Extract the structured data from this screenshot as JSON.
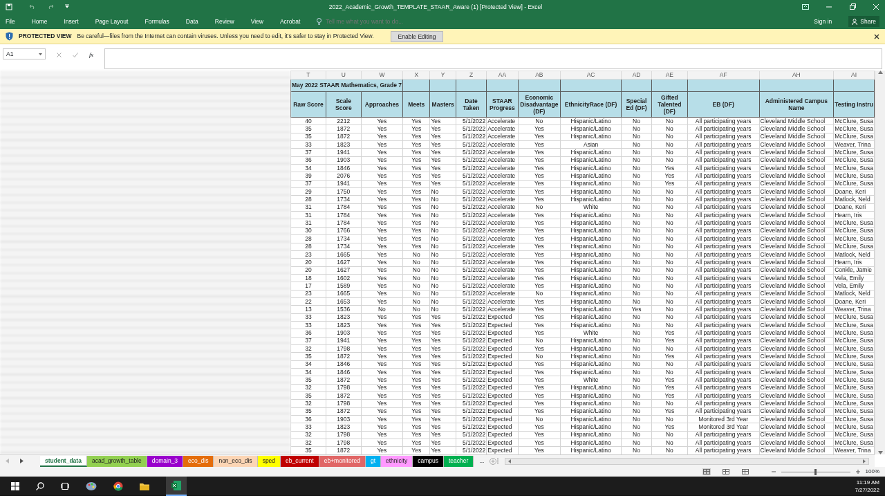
{
  "window": {
    "title": "2022_Academic_Growth_TEMPLATE_STAAR_Aware (1)  [Protected View] - Excel"
  },
  "ribbon_tabs": [
    "File",
    "Home",
    "Insert",
    "Page Layout",
    "Formulas",
    "Data",
    "Review",
    "View",
    "Acrobat"
  ],
  "tell_me": {
    "placeholder": "Tell me what you want to do..."
  },
  "account": {
    "sign_in": "Sign in",
    "share": "Share"
  },
  "protected_view": {
    "title": "PROTECTED VIEW",
    "message": "Be careful—files from the Internet can contain viruses. Unless you need to edit, it's safer to stay in Protected View.",
    "button": "Enable Editing"
  },
  "formula_bar": {
    "name_box": "A1",
    "fx": "fx"
  },
  "sheet": {
    "column_letters": [
      "T",
      "U",
      "W",
      "X",
      "Y",
      "Z",
      "AA",
      "AB",
      "AC",
      "AD",
      "AE",
      "AF",
      "AH",
      "AI"
    ],
    "title": "May 2022 STAAR Mathematics, Grade 7",
    "columns": [
      "Raw Score",
      "Scale Score",
      "Approaches",
      "Meets",
      "Masters",
      "Date Taken",
      "STAAR Progress",
      "Economic Disadvantage (DF)",
      "EthnicityRace (DF)",
      "Special Ed (DF)",
      "Gifted Talented (DF)",
      "EB (DF)",
      "Administered Campus Name",
      "Testing Instru"
    ],
    "rows": [
      [
        "40",
        "2212",
        "Yes",
        "Yes",
        "Yes",
        "5/1/2022",
        "Accelerate",
        "No",
        "Hispanic/Latino",
        "No",
        "No",
        "All participating years",
        "Cleveland Middle School",
        "McClure, Susa"
      ],
      [
        "35",
        "1872",
        "Yes",
        "Yes",
        "Yes",
        "5/1/2022",
        "Accelerate",
        "Yes",
        "Hispanic/Latino",
        "No",
        "No",
        "All participating years",
        "Cleveland Middle School",
        "McClure, Susa"
      ],
      [
        "35",
        "1872",
        "Yes",
        "Yes",
        "Yes",
        "5/1/2022",
        "Accelerate",
        "Yes",
        "Hispanic/Latino",
        "No",
        "No",
        "All participating years",
        "Cleveland Middle School",
        "McClure, Susa"
      ],
      [
        "33",
        "1823",
        "Yes",
        "Yes",
        "Yes",
        "5/1/2022",
        "Accelerate",
        "Yes",
        "Asian",
        "No",
        "No",
        "All participating years",
        "Cleveland Middle School",
        "Weaver, Trina"
      ],
      [
        "37",
        "1941",
        "Yes",
        "Yes",
        "Yes",
        "5/1/2022",
        "Accelerate",
        "Yes",
        "Hispanic/Latino",
        "No",
        "No",
        "All participating years",
        "Cleveland Middle School",
        "McClure, Susa"
      ],
      [
        "36",
        "1903",
        "Yes",
        "Yes",
        "Yes",
        "5/1/2022",
        "Accelerate",
        "Yes",
        "Hispanic/Latino",
        "No",
        "No",
        "All participating years",
        "Cleveland Middle School",
        "McClure, Susa"
      ],
      [
        "34",
        "1846",
        "Yes",
        "Yes",
        "Yes",
        "5/1/2022",
        "Accelerate",
        "Yes",
        "Hispanic/Latino",
        "No",
        "Yes",
        "All participating years",
        "Cleveland Middle School",
        "McClure, Susa"
      ],
      [
        "39",
        "2076",
        "Yes",
        "Yes",
        "Yes",
        "5/1/2022",
        "Accelerate",
        "Yes",
        "Hispanic/Latino",
        "No",
        "Yes",
        "All participating years",
        "Cleveland Middle School",
        "McClure, Susa"
      ],
      [
        "37",
        "1941",
        "Yes",
        "Yes",
        "Yes",
        "5/1/2022",
        "Accelerate",
        "Yes",
        "Hispanic/Latino",
        "No",
        "Yes",
        "All participating years",
        "Cleveland Middle School",
        "McClure, Susa"
      ],
      [
        "29",
        "1750",
        "Yes",
        "Yes",
        "No",
        "5/1/2022",
        "Accelerate",
        "Yes",
        "Hispanic/Latino",
        "No",
        "No",
        "All participating years",
        "Cleveland Middle School",
        "Doane, Keri"
      ],
      [
        "28",
        "1734",
        "Yes",
        "Yes",
        "No",
        "5/1/2022",
        "Accelerate",
        "Yes",
        "Hispanic/Latino",
        "No",
        "No",
        "All participating years",
        "Cleveland Middle School",
        "Matlock, Neld"
      ],
      [
        "31",
        "1784",
        "Yes",
        "Yes",
        "No",
        "5/1/2022",
        "Accelerate",
        "No",
        "White",
        "No",
        "No",
        "All participating years",
        "Cleveland Middle School",
        "Doane, Keri"
      ],
      [
        "31",
        "1784",
        "Yes",
        "Yes",
        "No",
        "5/1/2022",
        "Accelerate",
        "Yes",
        "Hispanic/Latino",
        "No",
        "No",
        "All participating years",
        "Cleveland Middle School",
        "Hearn, Iris"
      ],
      [
        "31",
        "1784",
        "Yes",
        "Yes",
        "No",
        "5/1/2022",
        "Accelerate",
        "Yes",
        "Hispanic/Latino",
        "No",
        "No",
        "All participating years",
        "Cleveland Middle School",
        "McClure, Susa"
      ],
      [
        "30",
        "1766",
        "Yes",
        "Yes",
        "No",
        "5/1/2022",
        "Accelerate",
        "Yes",
        "Hispanic/Latino",
        "No",
        "No",
        "All participating years",
        "Cleveland Middle School",
        "McClure, Susa"
      ],
      [
        "28",
        "1734",
        "Yes",
        "Yes",
        "No",
        "5/1/2022",
        "Accelerate",
        "Yes",
        "Hispanic/Latino",
        "No",
        "No",
        "All participating years",
        "Cleveland Middle School",
        "McClure, Susa"
      ],
      [
        "28",
        "1734",
        "Yes",
        "Yes",
        "No",
        "5/1/2022",
        "Accelerate",
        "Yes",
        "Hispanic/Latino",
        "No",
        "No",
        "All participating years",
        "Cleveland Middle School",
        "McClure, Susa"
      ],
      [
        "23",
        "1665",
        "Yes",
        "No",
        "No",
        "5/1/2022",
        "Accelerate",
        "Yes",
        "Hispanic/Latino",
        "No",
        "No",
        "All participating years",
        "Cleveland Middle School",
        "Matlock, Neld"
      ],
      [
        "20",
        "1627",
        "Yes",
        "No",
        "No",
        "5/1/2022",
        "Accelerate",
        "Yes",
        "Hispanic/Latino",
        "No",
        "No",
        "All participating years",
        "Cleveland Middle School",
        "Hearn, Iris"
      ],
      [
        "20",
        "1627",
        "Yes",
        "No",
        "No",
        "5/1/2022",
        "Accelerate",
        "Yes",
        "Hispanic/Latino",
        "No",
        "No",
        "All participating years",
        "Cleveland Middle School",
        "Conkle, Jamie"
      ],
      [
        "18",
        "1602",
        "Yes",
        "No",
        "No",
        "5/1/2022",
        "Accelerate",
        "Yes",
        "Hispanic/Latino",
        "No",
        "No",
        "All participating years",
        "Cleveland Middle School",
        "Vela, Emily"
      ],
      [
        "17",
        "1589",
        "Yes",
        "No",
        "No",
        "5/1/2022",
        "Accelerate",
        "Yes",
        "Hispanic/Latino",
        "No",
        "No",
        "All participating years",
        "Cleveland Middle School",
        "Vela, Emily"
      ],
      [
        "23",
        "1665",
        "Yes",
        "No",
        "No",
        "5/1/2022",
        "Accelerate",
        "No",
        "Hispanic/Latino",
        "No",
        "No",
        "All participating years",
        "Cleveland Middle School",
        "Matlock, Neld"
      ],
      [
        "22",
        "1653",
        "Yes",
        "No",
        "No",
        "5/1/2022",
        "Accelerate",
        "Yes",
        "Hispanic/Latino",
        "No",
        "No",
        "All participating years",
        "Cleveland Middle School",
        "Doane, Keri"
      ],
      [
        "13",
        "1536",
        "No",
        "No",
        "No",
        "5/1/2022",
        "Accelerate",
        "Yes",
        "Hispanic/Latino",
        "Yes",
        "No",
        "All participating years",
        "Cleveland Middle School",
        "Weaver, Trina"
      ],
      [
        "33",
        "1823",
        "Yes",
        "Yes",
        "Yes",
        "5/1/2022",
        "Expected",
        "Yes",
        "Hispanic/Latino",
        "No",
        "No",
        "All participating years",
        "Cleveland Middle School",
        "McClure, Susa"
      ],
      [
        "33",
        "1823",
        "Yes",
        "Yes",
        "Yes",
        "5/1/2022",
        "Expected",
        "Yes",
        "Hispanic/Latino",
        "No",
        "No",
        "All participating years",
        "Cleveland Middle School",
        "McClure, Susa"
      ],
      [
        "36",
        "1903",
        "Yes",
        "Yes",
        "Yes",
        "5/1/2022",
        "Expected",
        "Yes",
        "White",
        "No",
        "Yes",
        "All participating years",
        "Cleveland Middle School",
        "McClure, Susa"
      ],
      [
        "37",
        "1941",
        "Yes",
        "Yes",
        "Yes",
        "5/1/2022",
        "Expected",
        "No",
        "Hispanic/Latino",
        "No",
        "Yes",
        "All participating years",
        "Cleveland Middle School",
        "McClure, Susa"
      ],
      [
        "32",
        "1798",
        "Yes",
        "Yes",
        "Yes",
        "5/1/2022",
        "Expected",
        "Yes",
        "Hispanic/Latino",
        "No",
        "No",
        "All participating years",
        "Cleveland Middle School",
        "McClure, Susa"
      ],
      [
        "35",
        "1872",
        "Yes",
        "Yes",
        "Yes",
        "5/1/2022",
        "Expected",
        "No",
        "Hispanic/Latino",
        "No",
        "Yes",
        "All participating years",
        "Cleveland Middle School",
        "McClure, Susa"
      ],
      [
        "34",
        "1846",
        "Yes",
        "Yes",
        "Yes",
        "5/1/2022",
        "Expected",
        "Yes",
        "Hispanic/Latino",
        "No",
        "No",
        "All participating years",
        "Cleveland Middle School",
        "McClure, Susa"
      ],
      [
        "34",
        "1846",
        "Yes",
        "Yes",
        "Yes",
        "5/1/2022",
        "Expected",
        "Yes",
        "Hispanic/Latino",
        "No",
        "No",
        "All participating years",
        "Cleveland Middle School",
        "McClure, Susa"
      ],
      [
        "35",
        "1872",
        "Yes",
        "Yes",
        "Yes",
        "5/1/2022",
        "Expected",
        "Yes",
        "White",
        "No",
        "Yes",
        "All participating years",
        "Cleveland Middle School",
        "McClure, Susa"
      ],
      [
        "32",
        "1798",
        "Yes",
        "Yes",
        "Yes",
        "5/1/2022",
        "Expected",
        "Yes",
        "Hispanic/Latino",
        "No",
        "Yes",
        "All participating years",
        "Cleveland Middle School",
        "McClure, Susa"
      ],
      [
        "35",
        "1872",
        "Yes",
        "Yes",
        "Yes",
        "5/1/2022",
        "Expected",
        "Yes",
        "Hispanic/Latino",
        "No",
        "Yes",
        "All participating years",
        "Cleveland Middle School",
        "McClure, Susa"
      ],
      [
        "32",
        "1798",
        "Yes",
        "Yes",
        "Yes",
        "5/1/2022",
        "Expected",
        "Yes",
        "Hispanic/Latino",
        "No",
        "No",
        "All participating years",
        "Cleveland Middle School",
        "McClure, Susa"
      ],
      [
        "35",
        "1872",
        "Yes",
        "Yes",
        "Yes",
        "5/1/2022",
        "Expected",
        "Yes",
        "Hispanic/Latino",
        "No",
        "Yes",
        "All participating years",
        "Cleveland Middle School",
        "McClure, Susa"
      ],
      [
        "36",
        "1903",
        "Yes",
        "Yes",
        "Yes",
        "5/1/2022",
        "Expected",
        "No",
        "Hispanic/Latino",
        "No",
        "No",
        "Monitored 3rd Year",
        "Cleveland Middle School",
        "McClure, Susa"
      ],
      [
        "33",
        "1823",
        "Yes",
        "Yes",
        "Yes",
        "5/1/2022",
        "Expected",
        "Yes",
        "Hispanic/Latino",
        "No",
        "Yes",
        "Monitored 3rd Year",
        "Cleveland Middle School",
        "McClure, Susa"
      ],
      [
        "32",
        "1798",
        "Yes",
        "Yes",
        "Yes",
        "5/1/2022",
        "Expected",
        "Yes",
        "Hispanic/Latino",
        "No",
        "No",
        "All participating years",
        "Cleveland Middle School",
        "McClure, Susa"
      ],
      [
        "32",
        "1798",
        "Yes",
        "Yes",
        "Yes",
        "5/1/2022",
        "Expected",
        "Yes",
        "Hispanic/Latino",
        "No",
        "No",
        "All participating years",
        "Cleveland Middle School",
        "McClure, Susa"
      ],
      [
        "35",
        "1872",
        "Yes",
        "Yes",
        "Yes",
        "5/1/2022",
        "Expected",
        "Yes",
        "Hispanic/Latino",
        "No",
        "No",
        "All participating years",
        "Cleveland Middle School",
        "Weaver, Trina"
      ]
    ]
  },
  "sheet_tabs": [
    {
      "label": "student_data",
      "color": "#ffffff",
      "selected": true
    },
    {
      "label": "acad_growth_table",
      "color": "#92d050",
      "selected": false
    },
    {
      "label": "domain_3",
      "color": "#9900cc",
      "selected": false
    },
    {
      "label": "eco_dis",
      "color": "#e46c0a",
      "selected": false
    },
    {
      "label": "non_eco_dis",
      "color": "#fcd5b4",
      "selected": false
    },
    {
      "label": "sped",
      "color": "#ffff00",
      "selected": false
    },
    {
      "label": "eb_current",
      "color": "#c00000",
      "selected": false
    },
    {
      "label": "eb+monitored",
      "color": "#e06666",
      "selected": false
    },
    {
      "label": "gt",
      "color": "#00b0f0",
      "selected": false
    },
    {
      "label": "ethnicity",
      "color": "#ff99ff",
      "selected": false
    },
    {
      "label": "campus",
      "color": "#000000",
      "selected": false
    },
    {
      "label": "teacher",
      "color": "#00b050",
      "selected": false
    }
  ],
  "more_tabs": "...",
  "status_bar": {
    "view_buttons": [
      {
        "selected": true
      },
      {
        "selected": false
      },
      {
        "selected": false
      }
    ],
    "zoom": {
      "level": 0.5,
      "label": "100%"
    }
  },
  "taskbar": {
    "time": "11:19 AM",
    "date": "7/27/2022"
  }
}
